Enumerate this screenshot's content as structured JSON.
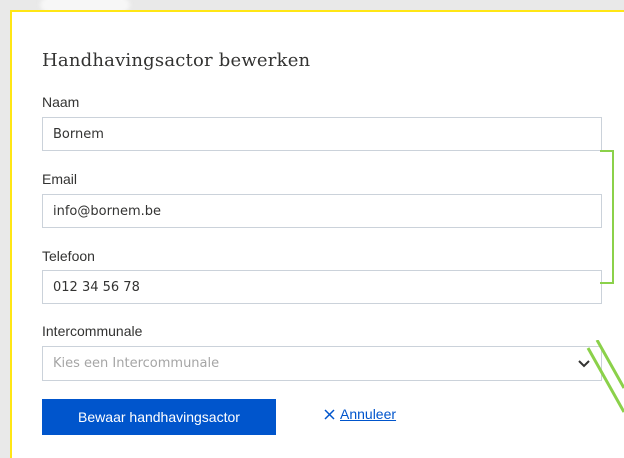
{
  "dialog": {
    "title": "Handhavingsactor bewerken"
  },
  "fields": {
    "naam": {
      "label": "Naam",
      "value": "Bornem"
    },
    "email": {
      "label": "Email",
      "value": "info@bornem.be"
    },
    "telefoon": {
      "label": "Telefoon",
      "value": "012 34 56 78"
    },
    "intercommunale": {
      "label": "Intercommunale",
      "placeholder": "Kies een Intercommunale"
    }
  },
  "actions": {
    "save_label": "Bewaar handhavingsactor",
    "cancel_label": "Annuleer"
  },
  "icons": {
    "cancel": "close-icon",
    "select": "chevron-down-icon"
  },
  "colors": {
    "primary": "#0055cc",
    "border_accent": "#ffe615",
    "annotation": "#8bd14a"
  }
}
